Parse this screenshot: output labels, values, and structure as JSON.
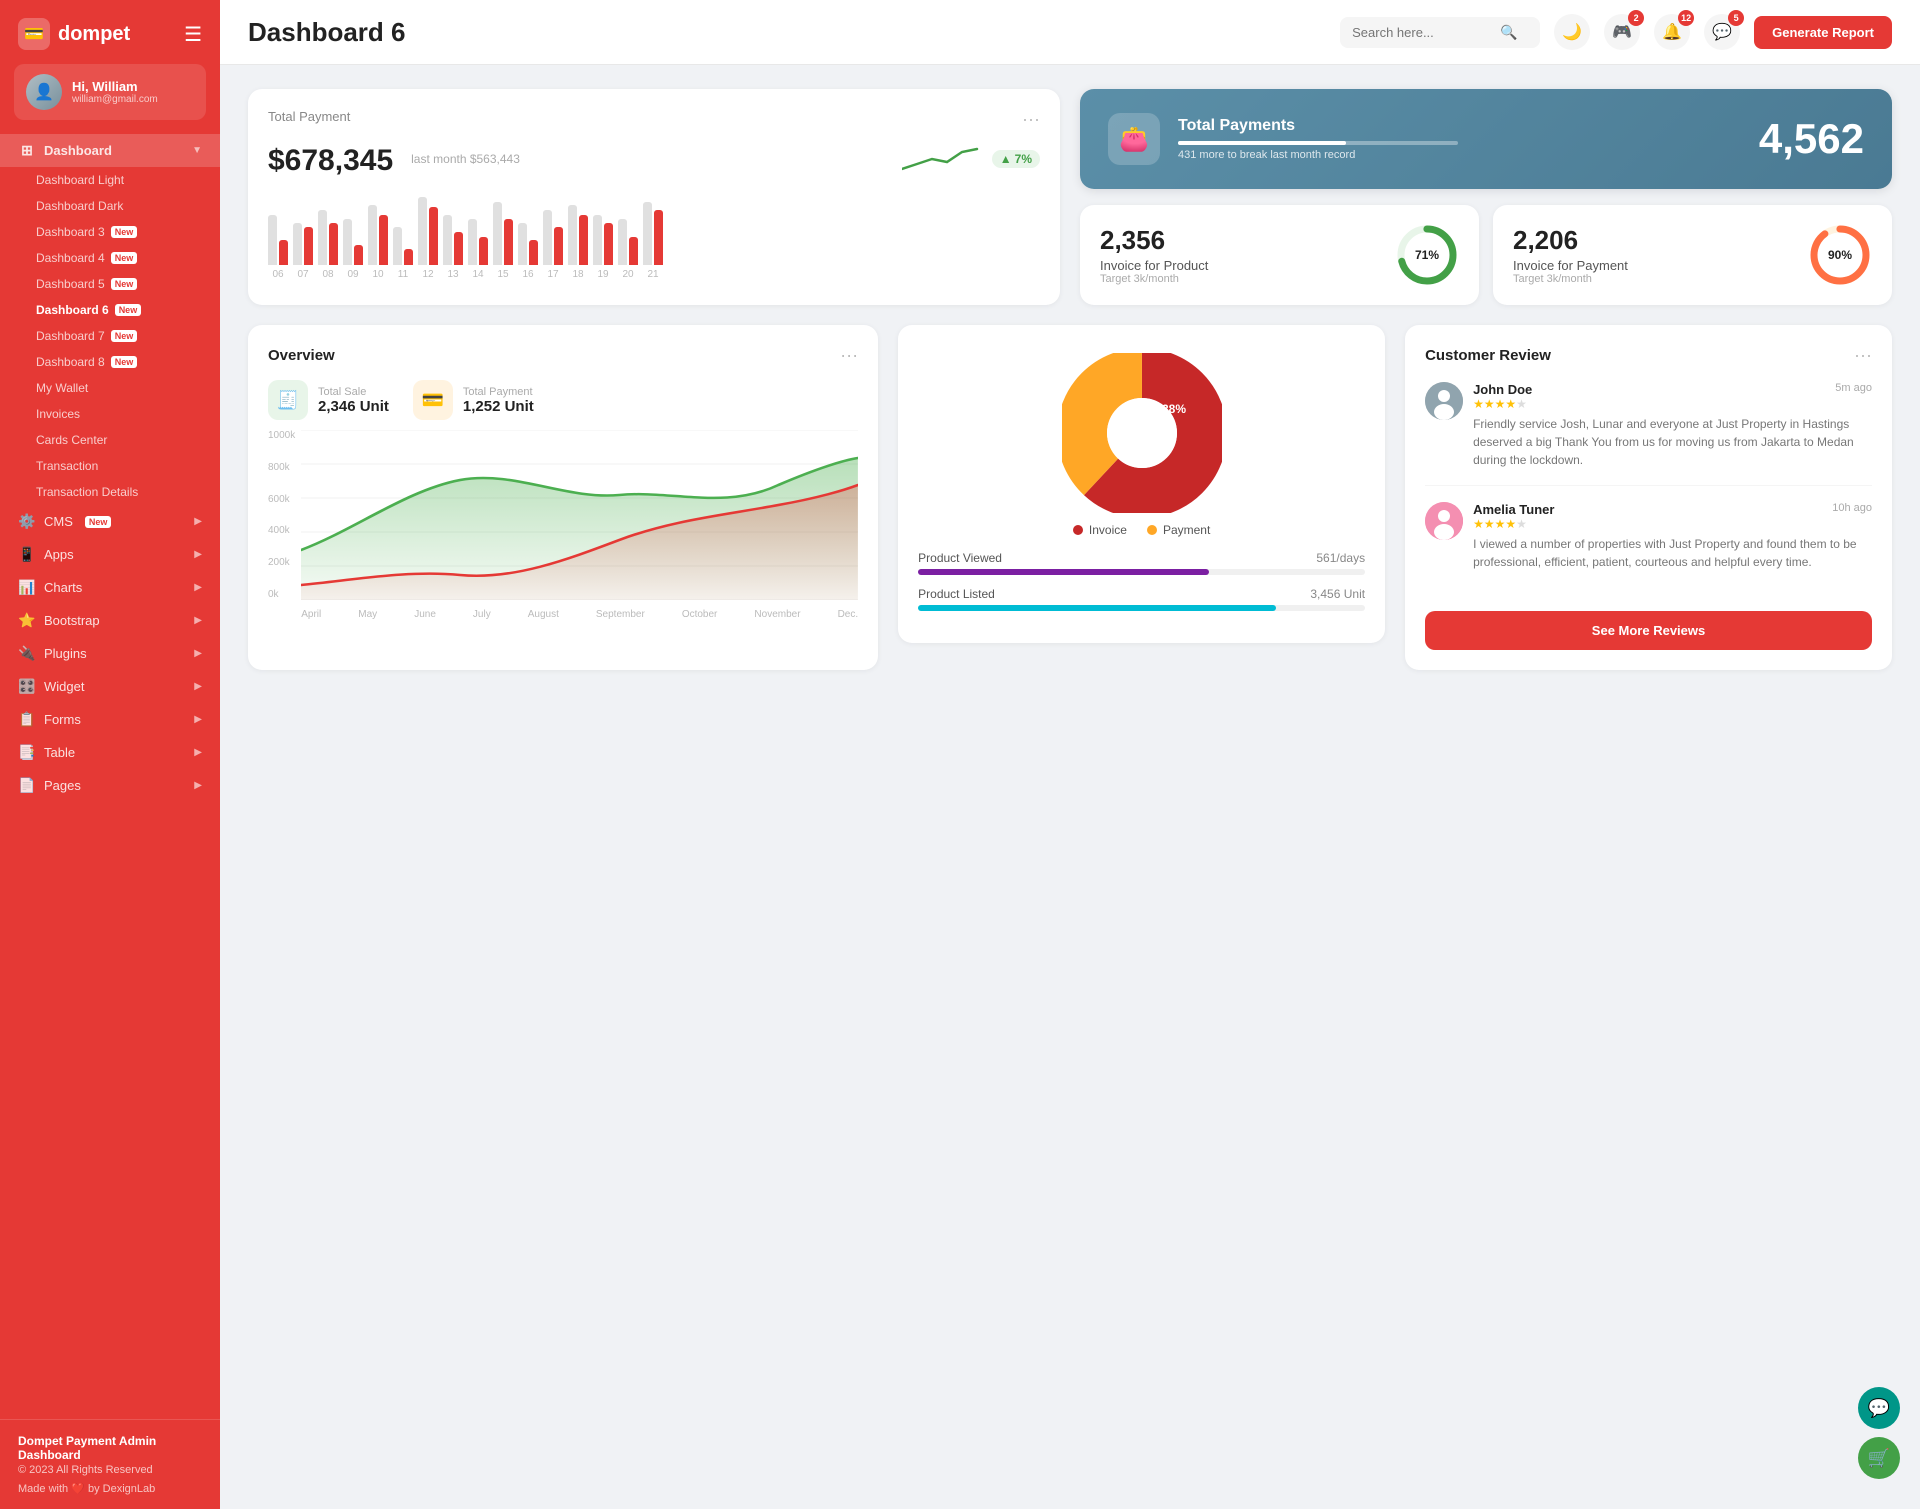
{
  "app": {
    "name": "dompet",
    "logo_icon": "💳"
  },
  "user": {
    "hi": "Hi, William",
    "name": "William",
    "email": "william@gmail.com",
    "avatar_icon": "👤"
  },
  "sidebar": {
    "dashboard_label": "Dashboard",
    "items": [
      {
        "label": "Dashboard Light",
        "id": "dashboard-light",
        "badge": null
      },
      {
        "label": "Dashboard Dark",
        "id": "dashboard-dark",
        "badge": null
      },
      {
        "label": "Dashboard 3",
        "id": "dashboard-3",
        "badge": "New"
      },
      {
        "label": "Dashboard 4",
        "id": "dashboard-4",
        "badge": "New"
      },
      {
        "label": "Dashboard 5",
        "id": "dashboard-5",
        "badge": "New"
      },
      {
        "label": "Dashboard 6",
        "id": "dashboard-6",
        "badge": "New",
        "active": true
      },
      {
        "label": "Dashboard 7",
        "id": "dashboard-7",
        "badge": "New"
      },
      {
        "label": "Dashboard 8",
        "id": "dashboard-8",
        "badge": "New"
      },
      {
        "label": "My Wallet",
        "id": "my-wallet",
        "badge": null
      },
      {
        "label": "Invoices",
        "id": "invoices",
        "badge": null
      },
      {
        "label": "Cards Center",
        "id": "cards-center",
        "badge": null
      },
      {
        "label": "Transaction",
        "id": "transaction",
        "badge": null
      },
      {
        "label": "Transaction Details",
        "id": "transaction-details",
        "badge": null
      }
    ],
    "nav_sections": [
      {
        "label": "CMS",
        "icon": "⚙️",
        "badge": "New",
        "has_arrow": true
      },
      {
        "label": "Apps",
        "icon": "📱",
        "badge": null,
        "has_arrow": true
      },
      {
        "label": "Charts",
        "icon": "📊",
        "badge": null,
        "has_arrow": true
      },
      {
        "label": "Bootstrap",
        "icon": "⭐",
        "badge": null,
        "has_arrow": true
      },
      {
        "label": "Plugins",
        "icon": "🔌",
        "badge": null,
        "has_arrow": true
      },
      {
        "label": "Widget",
        "icon": "🎛️",
        "badge": null,
        "has_arrow": true
      },
      {
        "label": "Forms",
        "icon": "📋",
        "badge": null,
        "has_arrow": true
      },
      {
        "label": "Table",
        "icon": "📑",
        "badge": null,
        "has_arrow": true
      },
      {
        "label": "Pages",
        "icon": "📄",
        "badge": null,
        "has_arrow": true
      }
    ],
    "footer": {
      "brand": "Dompet Payment Admin Dashboard",
      "copy": "© 2023 All Rights Reserved",
      "made": "Made with ❤️ by DexignLab"
    }
  },
  "header": {
    "title": "Dashboard 6",
    "search_placeholder": "Search here...",
    "notifications": [
      {
        "icon": "🎮",
        "count": 2
      },
      {
        "icon": "🔔",
        "count": 12
      },
      {
        "icon": "💬",
        "count": 5
      }
    ],
    "generate_btn": "Generate Report"
  },
  "total_payment": {
    "title": "Total Payment",
    "amount": "$678,345",
    "last_month_label": "last month $563,443",
    "trend": "7%",
    "trend_up": true,
    "bars": [
      {
        "grey": 60,
        "red": 30
      },
      {
        "grey": 50,
        "red": 45
      },
      {
        "grey": 65,
        "red": 50
      },
      {
        "grey": 55,
        "red": 25
      },
      {
        "grey": 70,
        "red": 60
      },
      {
        "grey": 45,
        "red": 20
      },
      {
        "grey": 80,
        "red": 70
      },
      {
        "grey": 60,
        "red": 40
      },
      {
        "grey": 55,
        "red": 35
      },
      {
        "grey": 75,
        "red": 55
      },
      {
        "grey": 50,
        "red": 30
      },
      {
        "grey": 65,
        "red": 45
      },
      {
        "grey": 70,
        "red": 60
      },
      {
        "grey": 60,
        "red": 50
      },
      {
        "grey": 55,
        "red": 35
      },
      {
        "grey": 75,
        "red": 65
      }
    ],
    "bar_labels": [
      "06",
      "07",
      "08",
      "09",
      "10",
      "11",
      "12",
      "13",
      "14",
      "15",
      "16",
      "17",
      "18",
      "19",
      "20",
      "21"
    ]
  },
  "total_payments_blue": {
    "title": "Total Payments",
    "subtitle": "431 more to break last month record",
    "number": "4,562",
    "bar_fill_pct": 60
  },
  "invoice_product": {
    "number": "2,356",
    "label": "Invoice for Product",
    "target": "Target 3k/month",
    "pct": 71,
    "color": "#43a047"
  },
  "invoice_payment": {
    "number": "2,206",
    "label": "Invoice for Payment",
    "target": "Target 3k/month",
    "pct": 90,
    "color": "#ff7043"
  },
  "overview": {
    "title": "Overview",
    "total_sale": {
      "label": "Total Sale",
      "value": "2,346 Unit"
    },
    "total_payment": {
      "label": "Total Payment",
      "value": "1,252 Unit"
    },
    "y_labels": [
      "1000k",
      "800k",
      "600k",
      "400k",
      "200k",
      "0k"
    ],
    "x_labels": [
      "April",
      "May",
      "June",
      "July",
      "August",
      "September",
      "October",
      "November",
      "Dec."
    ]
  },
  "pie_chart": {
    "invoice_pct": 62,
    "payment_pct": 38,
    "invoice_label": "Invoice",
    "payment_label": "Payment",
    "invoice_color": "#c62828",
    "payment_color": "#ffa726"
  },
  "product_stats": [
    {
      "label": "Product Viewed",
      "value": "561/days",
      "color": "#7b1fa2",
      "fill_pct": 65
    },
    {
      "label": "Product Listed",
      "value": "3,456 Unit",
      "color": "#00bcd4",
      "fill_pct": 80
    }
  ],
  "reviews": {
    "title": "Customer Review",
    "items": [
      {
        "name": "John Doe",
        "time": "5m ago",
        "stars": 4,
        "text": "Friendly service Josh, Lunar and everyone at Just Property in Hastings deserved a big Thank You from us for moving us from Jakarta to Medan during the lockdown.",
        "is_male": true
      },
      {
        "name": "Amelia Tuner",
        "time": "10h ago",
        "stars": 4,
        "text": "I viewed a number of properties with Just Property and found them to be professional, efficient, patient, courteous and helpful every time.",
        "is_male": false
      }
    ],
    "see_more_btn": "See More Reviews"
  },
  "floating": {
    "chat_icon": "💬",
    "cart_icon": "🛒"
  }
}
